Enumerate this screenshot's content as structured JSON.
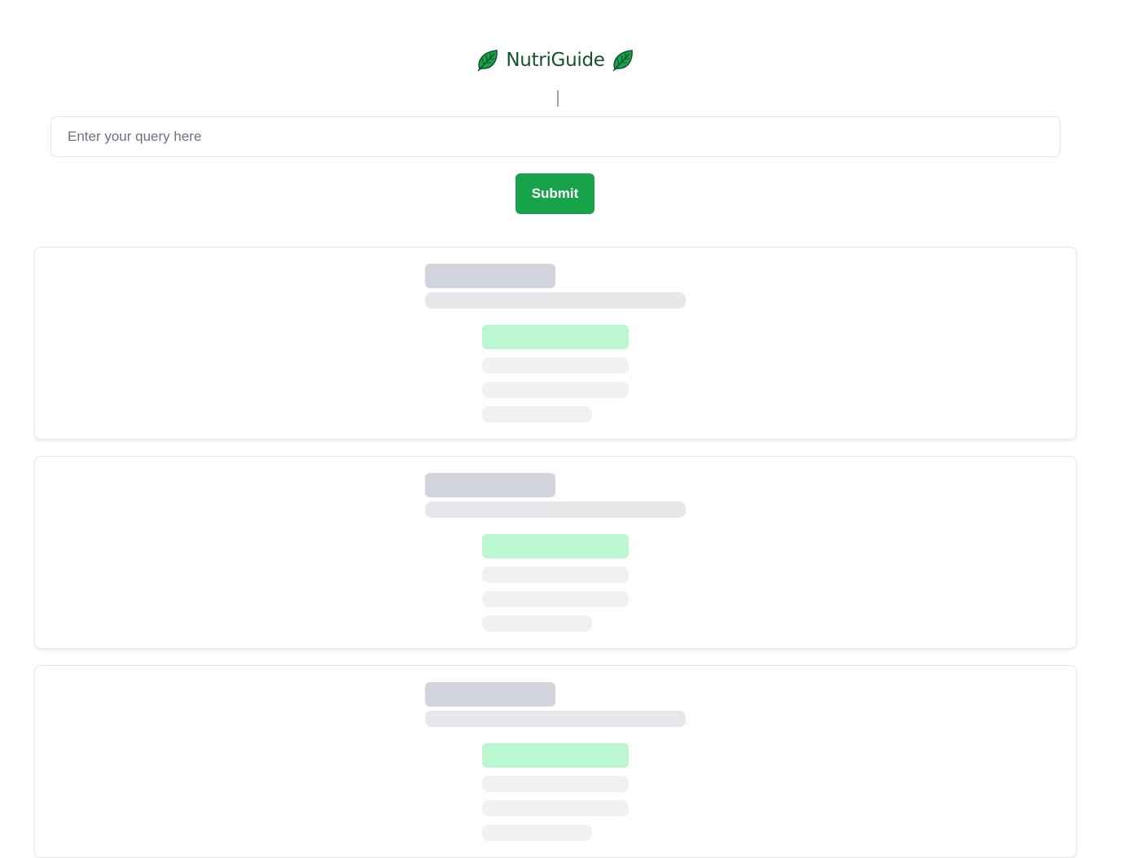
{
  "header": {
    "title": "NutriGuide",
    "leaf_icon": "leaf-icon",
    "leaf_color": "#15803d"
  },
  "search": {
    "placeholder": "Enter your query here",
    "value": ""
  },
  "actions": {
    "submit_label": "Submit",
    "submit_color": "#16a34a"
  },
  "results": {
    "state": "loading",
    "skeleton_colors": {
      "title": "#d1d5db",
      "subtitle": "#e5e7eb",
      "highlight": "#bbf7d0",
      "line": "#f0f1f3"
    }
  }
}
